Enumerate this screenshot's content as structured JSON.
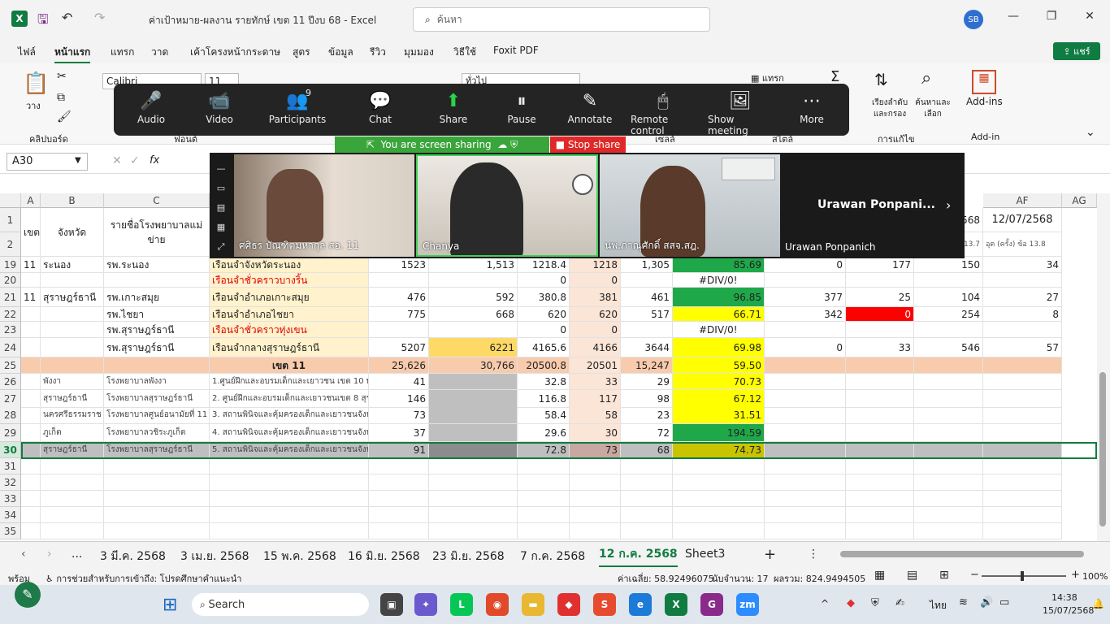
{
  "window": {
    "title": "ค่าเป้าหมาย-ผลงาน รายทักษ์ เขต 11 ปีงบ 68  -  Excel",
    "search_placeholder": "ค้นหา",
    "user_initials": "SB",
    "minimize": "—",
    "restore": "❐",
    "close": "✕"
  },
  "menu": {
    "items": [
      "ไฟล์",
      "หน้าแรก",
      "แทรก",
      "วาด",
      "เค้าโครงหน้ากระดาษ",
      "สูตร",
      "ข้อมูล",
      "รีวิว",
      "มุมมอง",
      "วิธีใช้",
      "Foxit PDF"
    ],
    "share": "แชร์"
  },
  "ribbon": {
    "paste": "วาง",
    "clipboard": "คลิปบอร์ด",
    "font_name": "Calibri",
    "font_size": "11",
    "number_format": "ทั่วไป",
    "insert": "แทรก",
    "sort_filter": "เรียงลำดับ และกรอง",
    "find_select": "ค้นหาและ เลือก",
    "addins": "Add-ins",
    "addins_group": "Add-in",
    "editing_group": "การแก้ไข",
    "font_group": "ฟอนต์",
    "cells_group": "เซลล์",
    "style_group": "สไตล์"
  },
  "formula": {
    "namebox": "A30",
    "fx": "fx"
  },
  "zoom": {
    "toolbar": [
      {
        "icon": "🎤",
        "label": "Audio"
      },
      {
        "icon": "📹",
        "label": "Video"
      },
      {
        "icon": "👥",
        "label": "Participants",
        "badge": "9"
      },
      {
        "icon": "💬",
        "label": "Chat"
      },
      {
        "icon": "⬆",
        "label": "Share"
      },
      {
        "icon": "⏸",
        "label": "Pause"
      },
      {
        "icon": "✎",
        "label": "Annotate"
      },
      {
        "icon": "🖱",
        "label": "Remote control"
      },
      {
        "icon": "🖼",
        "label": "Show meeting"
      },
      {
        "icon": "⋯",
        "label": "More"
      }
    ],
    "sharing_text": "You are screen sharing",
    "stop_share": "Stop share",
    "participants": [
      "ศศิธร บัณฑิตมหากุล สอ. 11",
      "Chanya",
      "นพ.ภาณุศักดิ์ สสจ.สฎ."
    ],
    "active_speaker_big": "Urawan  Ponpani...",
    "active_speaker": "Urawan Ponpanich"
  },
  "grid": {
    "col_headers": [
      "A",
      "B",
      "C",
      "AF",
      "AG"
    ],
    "right_header_values": {
      "c1": "2568",
      "af1": "12/07/2568",
      "c2": "13.7",
      "af2": "อุต (ครั้ง) ข้อ 13.8"
    },
    "hdr": {
      "a": "เขต",
      "b": "จังหวัด",
      "c": "รายชื่อโรงพยาบาลแม่ข่าย"
    },
    "rows": [
      {
        "n": "19",
        "a": "11",
        "b": "ระนอง",
        "c": "รพ.ระนอง",
        "d": "เรือนจำจังหวัดระนอง",
        "e": "1523",
        "f": "1,513",
        "g": "1218.4",
        "h": "1218",
        "i": "1,305",
        "j": "85.69",
        "k": "0",
        "l": "177",
        "m": "150",
        "o": "34"
      },
      {
        "n": "20",
        "a": "",
        "b": "",
        "c": "",
        "d": "เรือนจำชั่วคราวบางริ้น",
        "e": "",
        "f": "",
        "g": "0",
        "h": "0",
        "i": "",
        "j": "#DIV/0!",
        "k": "",
        "l": "",
        "m": "",
        "o": ""
      },
      {
        "n": "21",
        "a": "11",
        "b": "สุราษฎร์ธานี",
        "c": "รพ.เกาะสมุย",
        "d": "เรือนจำอำเภอเกาะสมุย",
        "e": "476",
        "f": "592",
        "g": "380.8",
        "h": "381",
        "i": "461",
        "j": "96.85",
        "k": "377",
        "l": "25",
        "m": "104",
        "o": "27"
      },
      {
        "n": "22",
        "a": "",
        "b": "",
        "c": "รพ.ไชยา",
        "d": "เรือนจำอำเภอไชยา",
        "e": "775",
        "f": "668",
        "g": "620",
        "h": "620",
        "i": "517",
        "j": "66.71",
        "k": "342",
        "l": "0",
        "m": "254",
        "o": "8"
      },
      {
        "n": "23",
        "a": "",
        "b": "",
        "c": "รพ.สุราษฎร์ธานี",
        "d": "เรือนจำชั่วคราวทุ่งเขน",
        "e": "",
        "f": "",
        "g": "0",
        "h": "0",
        "i": "",
        "j": "#DIV/0!",
        "k": "",
        "l": "",
        "m": "",
        "o": ""
      },
      {
        "n": "24",
        "a": "",
        "b": "",
        "c": "รพ.สุราษฎร์ธานี",
        "d": "เรือนจำกลางสุราษฎร์ธานี",
        "e": "5207",
        "f": "6221",
        "g": "4165.6",
        "h": "4166",
        "i": "3644",
        "j": "69.98",
        "k": "0",
        "l": "33",
        "m": "546",
        "o": "57"
      },
      {
        "n": "25",
        "a": "",
        "b": "",
        "c": "",
        "d": "เขต 11",
        "e": "25,626",
        "f": "30,766",
        "g": "20500.8",
        "h": "20501",
        "i": "15,247",
        "j": "59.50",
        "k": "",
        "l": "",
        "m": "",
        "o": ""
      },
      {
        "n": "26",
        "a": "",
        "b": "พังงา",
        "c": "โรงพยาบาลพังงา",
        "d": "1.ศูนย์ฝึกและอบรมเด็กและเยาวชน เขต 10 พังงา",
        "e": "41",
        "f": "",
        "g": "32.8",
        "h": "33",
        "i": "29",
        "j": "70.73",
        "k": "",
        "l": "",
        "m": "",
        "o": ""
      },
      {
        "n": "27",
        "a": "",
        "b": "สุราษฎร์ธานี",
        "c": "โรงพยาบาลสุราษฎร์ธานี",
        "d": "2. ศูนย์ฝึกและอบรมเด็กและเยาวชนเขต 8 สุราษฎร์",
        "e": "146",
        "f": "",
        "g": "116.8",
        "h": "117",
        "i": "98",
        "j": "67.12",
        "k": "",
        "l": "",
        "m": "",
        "o": ""
      },
      {
        "n": "28",
        "a": "",
        "b": "นครศรีธรรมราช",
        "c": "โรงพยาบาลศูนย์อนามัยที่ 11",
        "d": "3. สถานพินิจและคุ้มครองเด็กและเยาวชนจังหวัด",
        "e": "73",
        "f": "",
        "g": "58.4",
        "h": "58",
        "i": "23",
        "j": "31.51",
        "k": "",
        "l": "",
        "m": "",
        "o": ""
      },
      {
        "n": "29",
        "a": "",
        "b": "ภูเก็ต",
        "c": "โรงพยาบาลวชิระภูเก็ต",
        "d": "4. สถานพินิจและคุ้มครองเด็กและเยาวชนจังหวัด",
        "e": "37",
        "f": "",
        "g": "29.6",
        "h": "30",
        "i": "72",
        "j": "194.59",
        "k": "",
        "l": "",
        "m": "",
        "o": ""
      },
      {
        "n": "30",
        "a": "",
        "b": "สุราษฎร์ธานี",
        "c": "โรงพยาบาลสุราษฎร์ธานี",
        "d": "5. สถานพินิจและคุ้มครองเด็กและเยาวชนจังหวัด",
        "e": "91",
        "f": "",
        "g": "72.8",
        "h": "73",
        "i": "68",
        "j": "74.73",
        "k": "",
        "l": "",
        "m": "",
        "o": ""
      }
    ],
    "empty_rows": [
      "31",
      "32",
      "33",
      "34",
      "35"
    ]
  },
  "tabs": {
    "items": [
      "3 มี.ค. 2568",
      "3 เม.ย. 2568",
      "15 พ.ค. 2568",
      "16 มิ.ย. 2568",
      "23 มิ.ย. 2568",
      "7 ก.ค. 2568",
      "12 ก.ค. 2568",
      "Sheet3"
    ],
    "active": "12 ก.ค. 2568",
    "add": "+",
    "more": "⋮",
    "ellipsis": "..."
  },
  "status": {
    "ready": "พร้อม",
    "accessibility": "การช่วยสำหรับการเข้าถึง: โปรดศึกษาคำแนะนำ",
    "average": "ค่าเฉลี่ย: 58.92496075",
    "count": "นับจำนวน: 17",
    "sum": "ผลรวม: 824.9494505",
    "zoom": "100%"
  },
  "taskbar": {
    "search": "Search",
    "lang": "ไทย",
    "time": "14:38",
    "date": "15/07/2568"
  },
  "colors": {
    "green": "#1fa84a",
    "yellow": "#ffff00",
    "red": "#ff0000",
    "peach": "#fbe5d6",
    "cream": "#fff2cc",
    "orange_band": "#f8cbad",
    "gray_band": "#bfbfbf",
    "excel_green": "#107c41"
  }
}
